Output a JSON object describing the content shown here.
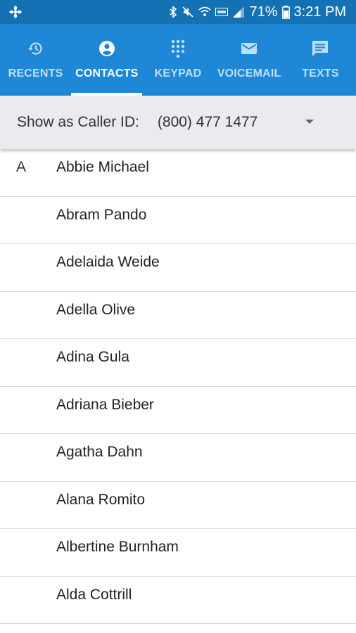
{
  "status_bar": {
    "battery_percent": "71%",
    "time": "3:21 PM",
    "icons": [
      "app-notification-icon",
      "bluetooth-icon",
      "mute-icon",
      "wifi-icon",
      "volte-icon",
      "signal-icon",
      "battery-icon"
    ]
  },
  "tabs": [
    {
      "label": "RECENTS",
      "icon": "history-icon",
      "active": false
    },
    {
      "label": "CONTACTS",
      "icon": "account-circle-icon",
      "active": true
    },
    {
      "label": "KEYPAD",
      "icon": "dialpad-icon",
      "active": false
    },
    {
      "label": "VOICEMAIL",
      "icon": "mail-icon",
      "active": false
    },
    {
      "label": "TEXTS",
      "icon": "message-icon",
      "active": false
    }
  ],
  "caller_id": {
    "label": "Show as Caller ID:",
    "value": "(800) 477 1477"
  },
  "contacts": {
    "section_letter": "A",
    "items": [
      "Abbie Michael",
      "Abram Pando",
      "Adelaida Weide",
      "Adella Olive",
      "Adina Gula",
      "Adriana Bieber",
      "Agatha Dahn",
      "Alana Romito",
      "Albertine Burnham",
      "Alda Cottrill"
    ]
  },
  "colors": {
    "status_bar": "#1471b3",
    "tab_bar": "#1e88d6",
    "caller_bar": "#e9ebee",
    "divider": "#dcdcdc"
  }
}
